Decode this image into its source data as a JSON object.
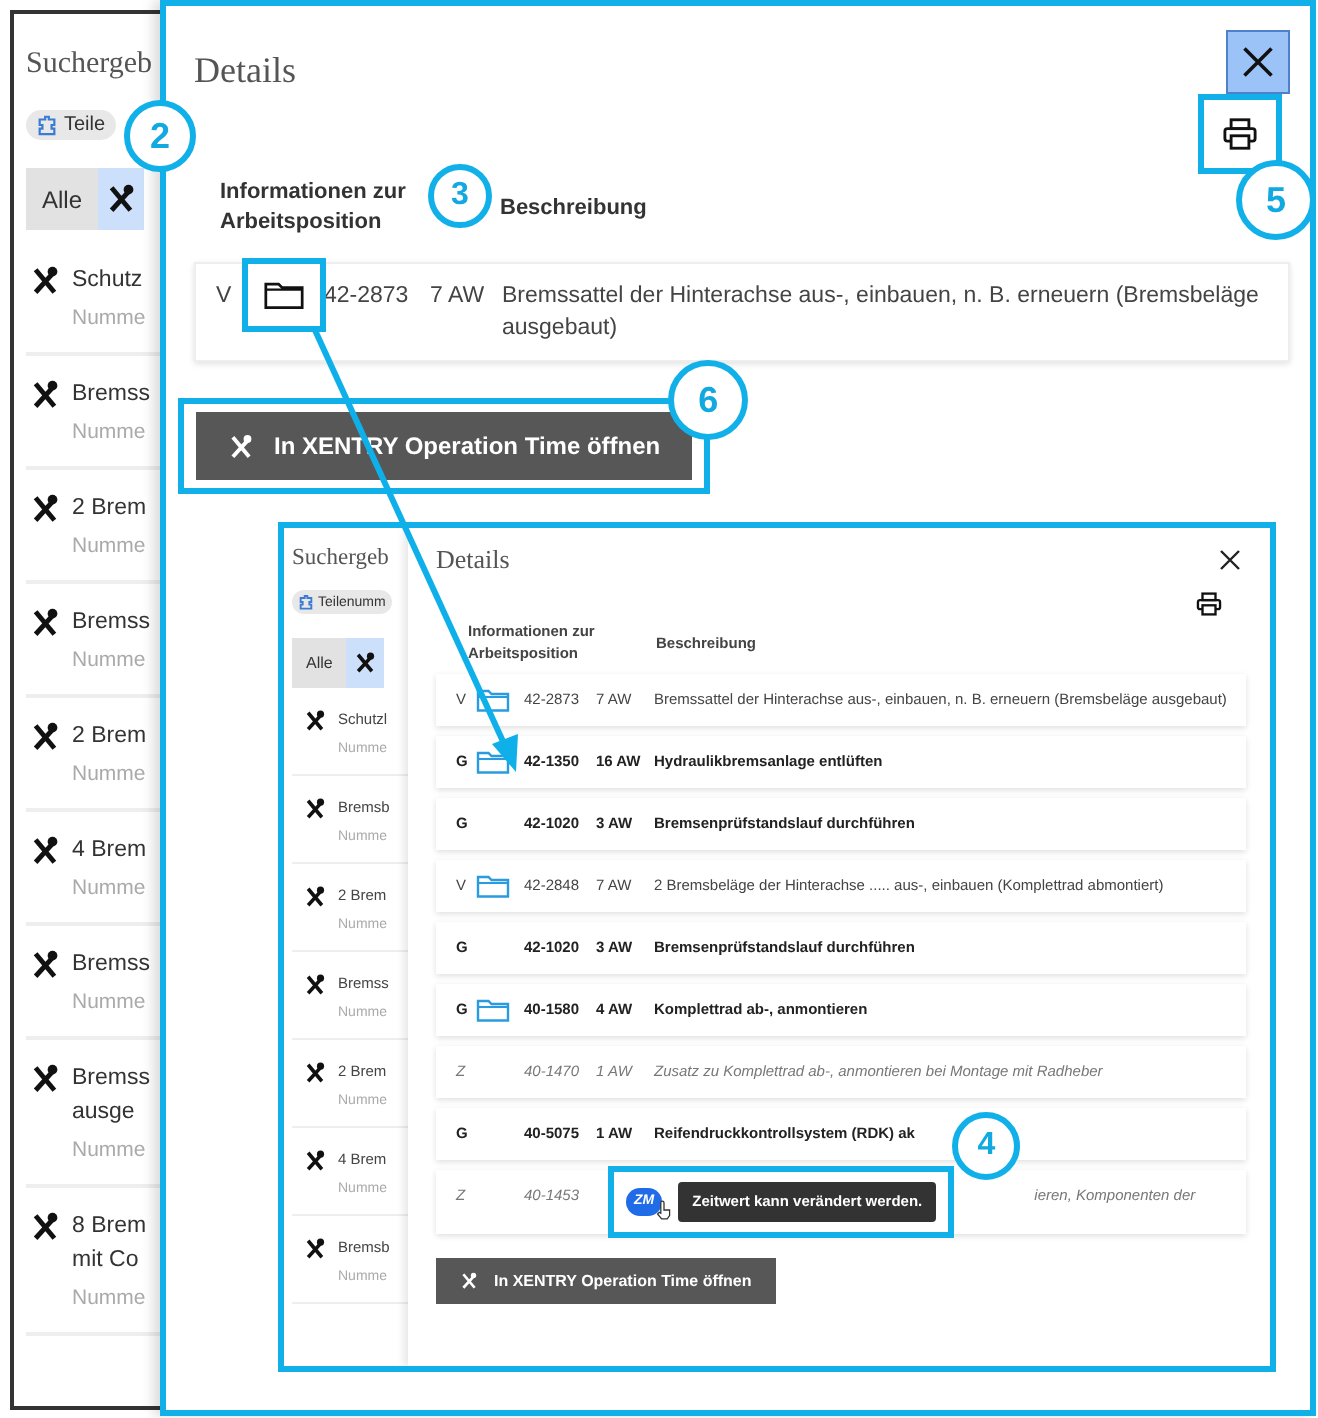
{
  "results_panel": {
    "title": "Suchergeb",
    "chip": "Teile",
    "tabs": [
      {
        "kind": "text",
        "label": "Alle",
        "selected": false
      },
      {
        "kind": "icon",
        "selected": true
      }
    ],
    "items": [
      {
        "lines": [
          "Schutz"
        ],
        "subtitle": "Numme"
      },
      {
        "lines": [
          "Bremss"
        ],
        "subtitle": "Numme"
      },
      {
        "lines": [
          "2 Brem"
        ],
        "subtitle": "Numme"
      },
      {
        "lines": [
          "Bremss"
        ],
        "subtitle": "Numme"
      },
      {
        "lines": [
          "2 Brem"
        ],
        "subtitle": "Numme"
      },
      {
        "lines": [
          "4 Brem"
        ],
        "subtitle": "Numme"
      },
      {
        "lines": [
          "Bremss"
        ],
        "subtitle": "Numme"
      },
      {
        "lines": [
          "Bremss",
          "ausge"
        ],
        "subtitle": "Numme"
      },
      {
        "lines": [
          "8 Brem",
          "mit Co"
        ],
        "subtitle": "Numme"
      }
    ]
  },
  "details": {
    "title": "Details",
    "columns": [
      "Informationen zur Arbeitsposition",
      "Beschreibung"
    ],
    "rows": [
      {
        "kind": "variant",
        "code": "V",
        "folder": true,
        "number": "42-2873",
        "time": "7 AW",
        "description": "Bremssattel der Hinterachse aus-, einbauen, n. B. erneuern (Bremsbeläge ausgebaut)"
      }
    ],
    "button": "In XENTRY Operation Time öffnen"
  },
  "embedded_screenshot": {
    "results_panel": {
      "title": "Suchergeb",
      "chip": "Teilenumm",
      "tabs": [
        {
          "kind": "text",
          "label": "Alle",
          "selected": false
        },
        {
          "kind": "icon",
          "selected": true
        }
      ],
      "items": [
        {
          "lines": [
            "Schutzl"
          ],
          "subtitle": "Numme"
        },
        {
          "lines": [
            "Bremsb"
          ],
          "subtitle": "Numme"
        },
        {
          "lines": [
            "2 Brem"
          ],
          "subtitle": "Numme"
        },
        {
          "lines": [
            "Bremss"
          ],
          "subtitle": "Numme"
        },
        {
          "lines": [
            "2 Brem"
          ],
          "subtitle": "Numme"
        },
        {
          "lines": [
            "4 Brem"
          ],
          "subtitle": "Numme"
        },
        {
          "lines": [
            "Bremsb"
          ],
          "subtitle": "Numme"
        }
      ]
    },
    "details": {
      "title": "Details",
      "columns": [
        "Informationen zur Arbeitsposition",
        "Beschreibung"
      ],
      "rows": [
        {
          "kind": "variant",
          "code": "V",
          "folder": true,
          "number": "42-2873",
          "time": "7 AW",
          "description": "Bremssattel der Hinterachse aus-, einbauen, n. B. erneuern (Bremsbeläge ausgebaut)"
        },
        {
          "kind": "basic",
          "code": "G",
          "folder": true,
          "number": "42-1350",
          "time": "16 AW",
          "description": "Hydraulikbremsanlage entlüften"
        },
        {
          "kind": "basic",
          "code": "G",
          "folder": false,
          "number": "42-1020",
          "time": "3 AW",
          "description": "Bremsenprüfstandslauf durchführen"
        },
        {
          "kind": "variant",
          "code": "V",
          "folder": true,
          "number": "42-2848",
          "time": "7 AW",
          "description": "2 Bremsbeläge der Hinterachse ..... aus-, einbauen (Komplettrad abmontiert)"
        },
        {
          "kind": "basic",
          "code": "G",
          "folder": false,
          "number": "42-1020",
          "time": "3 AW",
          "description": "Bremsenprüfstandslauf durchführen"
        },
        {
          "kind": "basic",
          "code": "G",
          "folder": true,
          "number": "40-1580",
          "time": "4 AW",
          "description": "Komplettrad ab-, anmontieren"
        },
        {
          "kind": "extra",
          "code": "Z",
          "folder": false,
          "number": "40-1470",
          "time": "1 AW",
          "description": "Zusatz zu Komplettrad ab-, anmontieren bei Montage mit Radheber"
        },
        {
          "kind": "basic",
          "code": "G",
          "folder": false,
          "number": "40-5075",
          "time": "1 AW",
          "description": "Reifendruckkontrollsystem (RDK) ak"
        },
        {
          "kind": "extra",
          "code": "Z",
          "folder": false,
          "number": "40-1453",
          "badge": "ZM",
          "tooltip": "Zeitwert kann verändert werden.",
          "description": "ieren, Komponenten der"
        }
      ],
      "button": "In XENTRY Operation Time öffnen"
    }
  },
  "callouts": [
    {
      "label": "2"
    },
    {
      "label": "3"
    },
    {
      "label": "5"
    },
    {
      "label": "6"
    },
    {
      "label": "4"
    }
  ]
}
